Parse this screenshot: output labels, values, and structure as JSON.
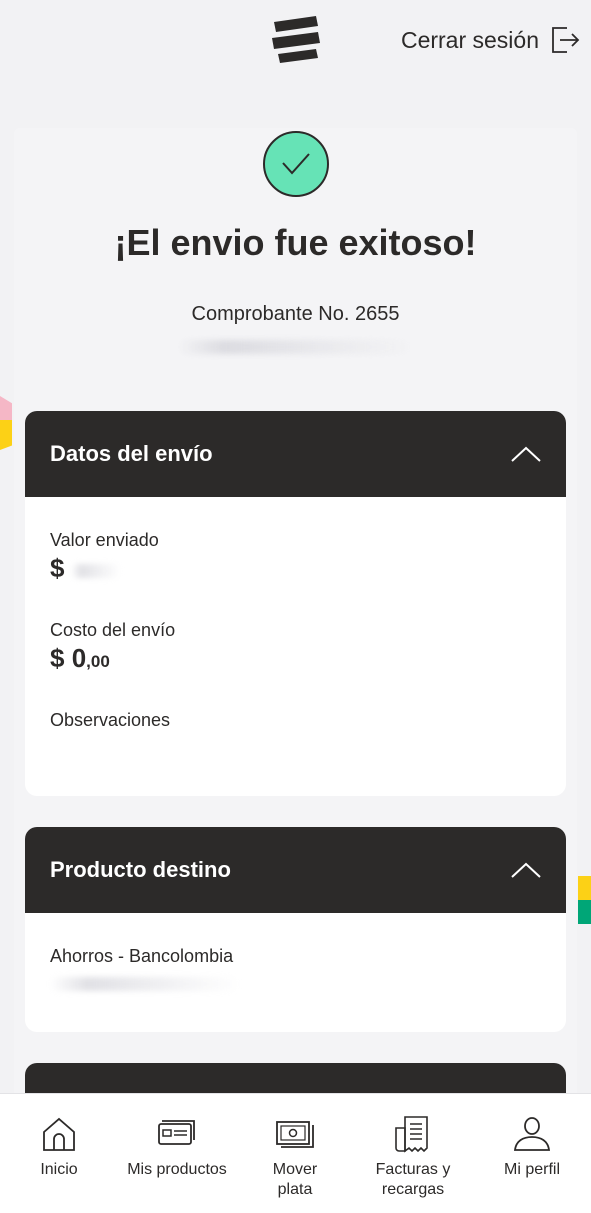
{
  "header": {
    "logout_label": "Cerrar sesión"
  },
  "success": {
    "title": "¡El envio fue exitoso!",
    "receipt": "Comprobante No. 2655"
  },
  "shipment": {
    "title": "Datos del envío",
    "sent_value_label": "Valor enviado",
    "sent_value_currency": "$",
    "cost_label": "Costo del envío",
    "cost_currency": "$",
    "cost_whole": "0",
    "cost_cents": ",00",
    "notes_label": "Observaciones"
  },
  "destination": {
    "title": "Producto destino",
    "account_type": "Ahorros - Bancolombia"
  },
  "nav": [
    {
      "label": "Inicio",
      "icon": "home-icon"
    },
    {
      "label": "Mis productos",
      "icon": "card-icon"
    },
    {
      "label": "Mover plata",
      "icon": "money-icon"
    },
    {
      "label": "Facturas y recargas",
      "icon": "bill-icon"
    },
    {
      "label": "Mi perfil",
      "icon": "profile-icon"
    }
  ],
  "colors": {
    "background": "#f2f2f4",
    "dark": "#2c2a29",
    "success_green": "#66e3b6",
    "brand_yellow": "#fcd116",
    "brand_green": "#00a677",
    "brand_pink": "#f5b7c6"
  }
}
